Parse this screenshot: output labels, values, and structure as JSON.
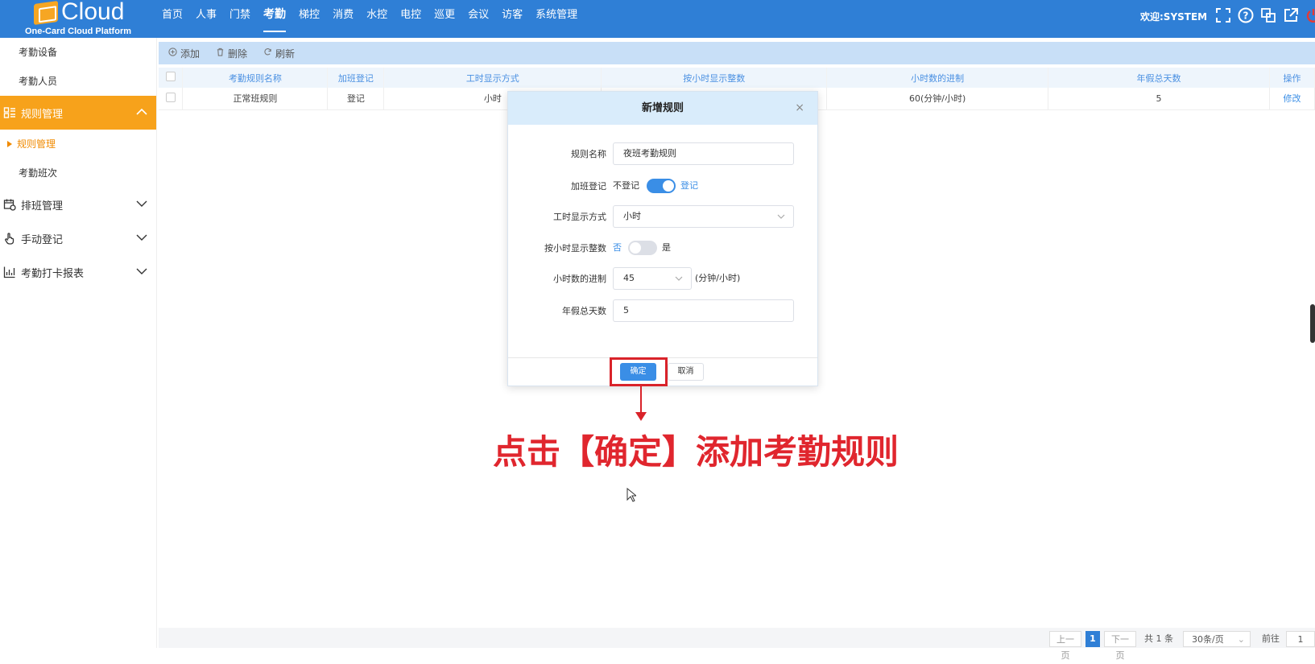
{
  "brand": {
    "name": "Cloud",
    "subtitle": "One-Card Cloud Platform"
  },
  "nav": {
    "items": [
      "首页",
      "人事",
      "门禁",
      "考勤",
      "梯控",
      "消费",
      "水控",
      "电控",
      "巡更",
      "会议",
      "访客",
      "系统管理"
    ],
    "active_index": 3
  },
  "header": {
    "welcome": "欢迎:SYSTEM"
  },
  "sidebar": {
    "item_device": "考勤设备",
    "item_people": "考勤人员",
    "group_rules": "规则管理",
    "sub_rules": "规则管理",
    "sub_shift": "考勤班次",
    "group_schedule": "排班管理",
    "group_manual": "手动登记",
    "group_report": "考勤打卡报表"
  },
  "toolbar": {
    "add": "添加",
    "delete": "删除",
    "refresh": "刷新"
  },
  "table": {
    "headers": [
      "考勤规则名称",
      "加班登记",
      "工时显示方式",
      "按小时显示整数",
      "小时数的进制",
      "年假总天数",
      "操作"
    ],
    "row": {
      "name": "正常班规则",
      "overtime": "登记",
      "display": "小时",
      "hours_int": "",
      "base": "60(分钟/小时)",
      "annual": "5",
      "action": "修改"
    }
  },
  "modal": {
    "title": "新增规则",
    "close": "×",
    "name_label": "规则名称",
    "name_value": "夜班考勤规则",
    "overtime_label": "加班登记",
    "overtime_off": "不登记",
    "overtime_on": "登记",
    "display_label": "工时显示方式",
    "display_value": "小时",
    "hours_int_label": "按小时显示整数",
    "hours_int_no": "否",
    "hours_int_yes": "是",
    "base_label": "小时数的进制",
    "base_value": "45",
    "base_unit": "(分钟/小时)",
    "annual_label": "年假总天数",
    "annual_value": "5",
    "ok": "确定",
    "cancel": "取消"
  },
  "annotation": "点击【确定】添加考勤规则",
  "pager": {
    "prev": "上一页",
    "current": "1",
    "next": "下一页",
    "total": "共 1 条",
    "per_page": "30条/页",
    "goto": "前往",
    "goto_value": "1"
  },
  "colors": {
    "topbar": "#2f7fd6",
    "active_group": "#f7a21b",
    "primary": "#3a8ee6",
    "annotation": "#e0262e"
  }
}
